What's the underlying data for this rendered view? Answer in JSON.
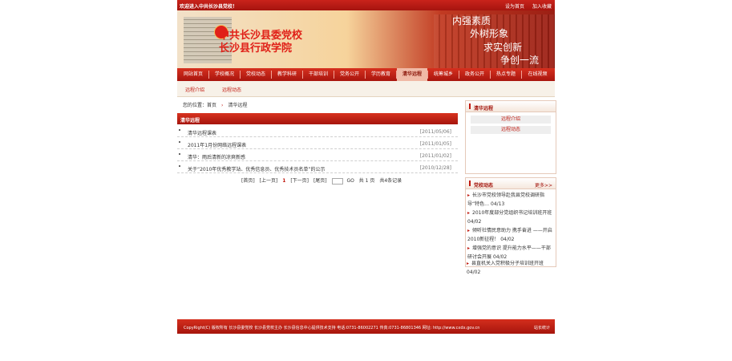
{
  "topbar": {
    "welcome": "欢迎进入中共长沙县党校！",
    "set_home": "设为首页",
    "add_favorite": "加入收藏"
  },
  "banner": {
    "title_line1": "中共长沙县委党校",
    "title_line2": "长沙县行政学院",
    "slogans": [
      "内强素质",
      "外树形象",
      "求实创新",
      "争创一流"
    ]
  },
  "nav": {
    "items": [
      "网站首页",
      "学校概况",
      "党校动态",
      "教学科研",
      "干部培训",
      "党务公开",
      "学历教育",
      "清华远程",
      "统筹城乡",
      "政务公开",
      "热点专题",
      "在线视频"
    ],
    "active_index": 7
  },
  "subnav": {
    "items": [
      "远程介绍",
      "远程动态"
    ]
  },
  "breadcrumb": {
    "label": "您的位置：",
    "home": "首页",
    "current": "清华远程"
  },
  "main": {
    "section_title": "清华远程",
    "articles": [
      {
        "title": "清华远程课表",
        "date": "[2011/05/06]"
      },
      {
        "title": "2011年1月份网络远程课表",
        "date": "[2011/01/05]"
      },
      {
        "title": "清华：雨后清新的凉爽新感",
        "date": "[2011/01/02]"
      },
      {
        "title": "关于“2010年优秀教学站、优秀信息员、优秀技术员名单”的公示",
        "date": "[2010/12/28]"
      }
    ],
    "pager": {
      "first": "[首页]",
      "prev": "[上一页]",
      "current": "1",
      "next": "[下一页]",
      "last": "[尾页]",
      "go": "GO",
      "summary": "共 1 页",
      "count": "共4条记录"
    }
  },
  "side": {
    "remote_title": "清华远程",
    "remote_links": [
      "远程介绍",
      "远程动态"
    ],
    "news_title": "党校动态",
    "news_more": "更多>>",
    "news": [
      {
        "text": "长沙市党校领导赴我县党校调研指导“特色…",
        "date": "04/13"
      },
      {
        "text": "2010年度部分党组织书记培训班开班",
        "date": "04/02"
      },
      {
        "text": "倾听社情民意助力 携手奋进 ——开启2010新征程！",
        "date": "04/02"
      },
      {
        "text": "增强党的意识 提升能力水平——干部研讨会开展",
        "date": "04/02"
      },
      {
        "text": "县直机关入党积极分子培训班开班",
        "date": "04/02"
      }
    ]
  },
  "footer": {
    "copyright": "CopyRight(C) 版权所有 长沙县委党校 长沙县党校主办 长沙县信息中心提供技术支持 电话:0731-86002271 传真:0731-86801346 网址: http://www.cxdx.gov.cn",
    "right": "站长统计"
  }
}
